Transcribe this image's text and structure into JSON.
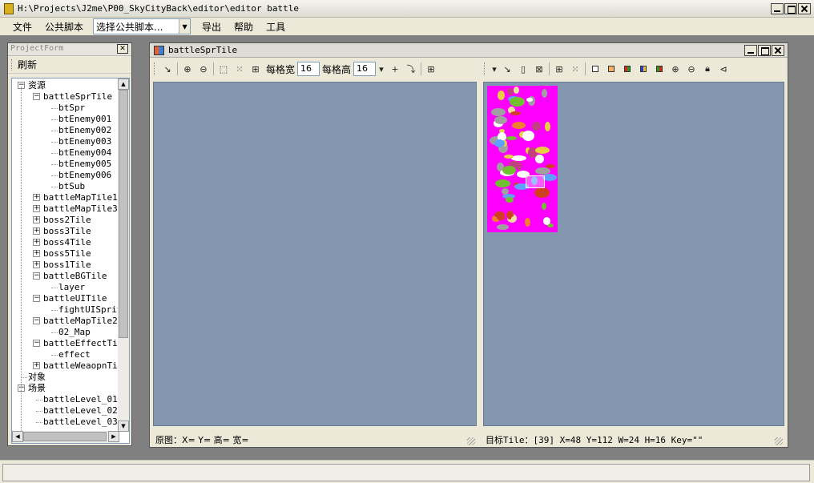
{
  "window": {
    "title": "H:\\Projects\\J2me\\P00_SkyCityBack\\editor\\editor battle"
  },
  "menu": {
    "items": [
      "文件",
      "公共脚本"
    ],
    "script_select": "选择公共脚本...",
    "items_after": [
      "导出",
      "帮助",
      "工具"
    ]
  },
  "project_panel": {
    "title": "ProjectForm",
    "refresh_label": "刷新",
    "tree": [
      {
        "label": "资源",
        "level": 0,
        "expanded": true
      },
      {
        "label": "battleSprTile",
        "level": 1,
        "expanded": true
      },
      {
        "label": "btSpr",
        "level": 2
      },
      {
        "label": "btEnemy001",
        "level": 2
      },
      {
        "label": "btEnemy002",
        "level": 2
      },
      {
        "label": "btEnemy003",
        "level": 2
      },
      {
        "label": "btEnemy004",
        "level": 2
      },
      {
        "label": "btEnemy005",
        "level": 2
      },
      {
        "label": "btEnemy006",
        "level": 2
      },
      {
        "label": "btSub",
        "level": 2
      },
      {
        "label": "battleMapTile1",
        "level": 1,
        "expanded": false
      },
      {
        "label": "battleMapTile3",
        "level": 1,
        "expanded": false
      },
      {
        "label": "boss2Tile",
        "level": 1,
        "expanded": false
      },
      {
        "label": "boss3Tile",
        "level": 1,
        "expanded": false
      },
      {
        "label": "boss4Tile",
        "level": 1,
        "expanded": false
      },
      {
        "label": "boss5Tile",
        "level": 1,
        "expanded": false
      },
      {
        "label": "boss1Tile",
        "level": 1,
        "expanded": false
      },
      {
        "label": "battleBGTile",
        "level": 1,
        "expanded": true
      },
      {
        "label": "layer",
        "level": 2
      },
      {
        "label": "battleUITile",
        "level": 1,
        "expanded": true
      },
      {
        "label": "fightUISprit",
        "level": 2
      },
      {
        "label": "battleMapTile2",
        "level": 1,
        "expanded": true
      },
      {
        "label": "02_Map",
        "level": 2
      },
      {
        "label": "battleEffectTil",
        "level": 1,
        "expanded": true
      },
      {
        "label": "effect",
        "level": 2
      },
      {
        "label": "battleWeaopnTil",
        "level": 1,
        "expanded": false
      },
      {
        "label": "对象",
        "level": 0
      },
      {
        "label": "场景",
        "level": 0,
        "expanded": true
      },
      {
        "label": "battleLevel_01",
        "level": 1
      },
      {
        "label": "battleLevel_02",
        "level": 1
      },
      {
        "label": "battleLevel_03",
        "level": 1
      }
    ]
  },
  "doc_window": {
    "title": "battleSprTile",
    "left_toolbar": {
      "cell_width_label": "每格宽",
      "cell_width": "16",
      "cell_height_label": "每格高",
      "cell_height": "16"
    },
    "left_status": "原图：X=  Y= 高= 宽=",
    "right_status": "目标Tile：[39] X=48 Y=112 W=24 H=16 Key=\"\""
  },
  "colors": {
    "canvas": "#8497b0",
    "sprite_bg": "#ff00ff",
    "chrome": "#ece9d8"
  }
}
